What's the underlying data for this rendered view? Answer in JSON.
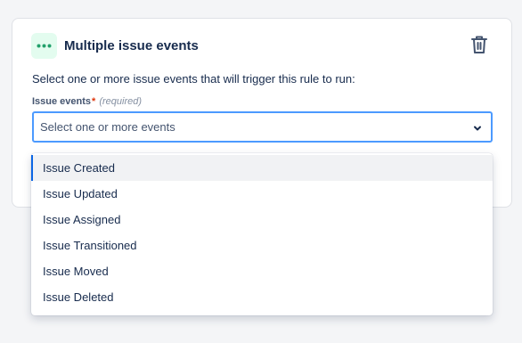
{
  "card": {
    "title": "Multiple issue events",
    "description": "Select one or more issue events that will trigger this rule to run:"
  },
  "field": {
    "label": "Issue events",
    "required_marker": "*",
    "required_text": "(required)",
    "placeholder": "Select one or more events"
  },
  "options": [
    {
      "label": "Issue Created",
      "highlighted": true
    },
    {
      "label": "Issue Updated",
      "highlighted": false
    },
    {
      "label": "Issue Assigned",
      "highlighted": false
    },
    {
      "label": "Issue Transitioned",
      "highlighted": false
    },
    {
      "label": "Issue Moved",
      "highlighted": false
    },
    {
      "label": "Issue Deleted",
      "highlighted": false
    }
  ],
  "icons": {
    "badge": "more-dots-icon",
    "delete": "trash-icon",
    "dropdown": "chevron-down-icon"
  },
  "colors": {
    "badge_bg": "#e3fcef",
    "badge_dots": "#22a06b",
    "focus_border": "#4c9aff",
    "required": "#de350b",
    "highlight_bar": "#0c66e4"
  }
}
